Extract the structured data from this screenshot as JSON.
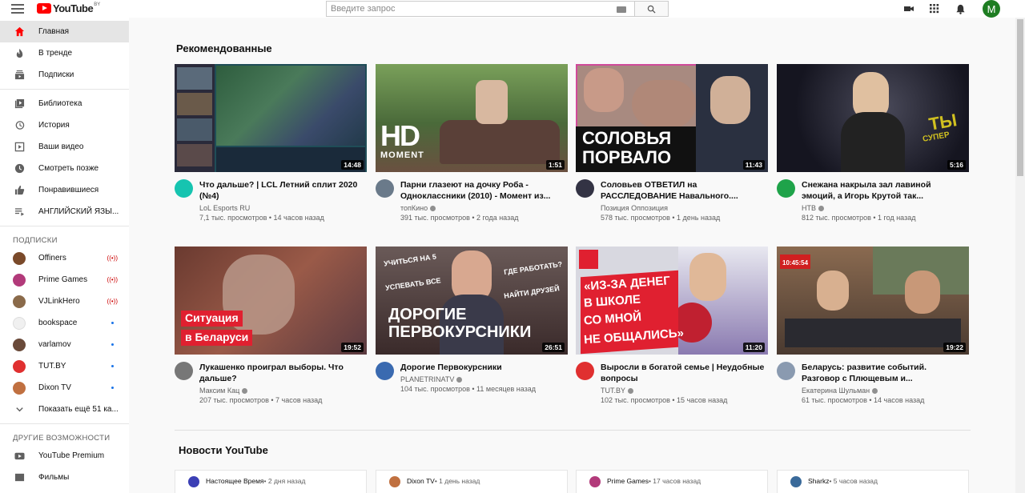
{
  "header": {
    "logo_text": "YouTube",
    "logo_region": "BY",
    "search_placeholder": "Введите запрос",
    "avatar_letter": "M"
  },
  "sidebar": {
    "main": [
      {
        "label": "Главная",
        "icon": "home-icon",
        "active": true
      },
      {
        "label": "В тренде",
        "icon": "trending-icon"
      },
      {
        "label": "Подписки",
        "icon": "subscriptions-icon"
      }
    ],
    "library": [
      {
        "label": "Библиотека",
        "icon": "library-icon"
      },
      {
        "label": "История",
        "icon": "history-icon"
      },
      {
        "label": "Ваши видео",
        "icon": "your-videos-icon"
      },
      {
        "label": "Смотреть позже",
        "icon": "watch-later-icon"
      },
      {
        "label": "Понравившиеся",
        "icon": "liked-icon"
      },
      {
        "label": "АНГЛИЙСКИЙ ЯЗЫ...",
        "icon": "playlist-icon"
      }
    ],
    "subscriptions_title": "ПОДПИСКИ",
    "subscriptions": [
      {
        "label": "Offiners",
        "color": "#7a4a2a",
        "badge": "live"
      },
      {
        "label": "Prime Games",
        "color": "#b23a7a",
        "badge": "live"
      },
      {
        "label": "VJLinkHero",
        "color": "#8a6a4a",
        "badge": "live"
      },
      {
        "label": "bookspace",
        "color": "#f0f0f0",
        "badge": "dot"
      },
      {
        "label": "varlamov",
        "color": "#6a4a3a",
        "badge": "dot"
      },
      {
        "label": "TUT.BY",
        "color": "#e03030",
        "badge": "dot"
      },
      {
        "label": "Dixon TV",
        "color": "#c07040",
        "badge": "dot"
      }
    ],
    "show_more": "Показать ещё 51 ка...",
    "other_title": "ДРУГИЕ ВОЗМОЖНОСТИ",
    "other": [
      {
        "label": "YouTube Premium",
        "icon": "youtube-premium-icon"
      },
      {
        "label": "Фильмы",
        "icon": "movies-icon"
      }
    ]
  },
  "main": {
    "recommended_title": "Рекомендованные",
    "videos": [
      {
        "title": "Что дальше? | LCL Летний сплит 2020 (№4)",
        "channel": "LoL Esports RU",
        "verified": false,
        "stats": "7,1 тыс. просмотров • 14 часов назад",
        "duration": "14:48",
        "avatar_color": "#16c4b0"
      },
      {
        "title": "Парни глазеют на дочку Роба - Одноклассники (2010) - Момент из...",
        "channel": "топКино",
        "verified": true,
        "stats": "391 тыс. просмотров • 2 года назад",
        "duration": "1:51",
        "avatar_color": "#6a7a8a",
        "thumb_text_1": "HD",
        "thumb_text_2": "MOMENT"
      },
      {
        "title": "Соловьев ОТВЕТИЛ на РАССЛЕДОВАНИЕ Навального....",
        "channel": "Позиция Оппозиция",
        "verified": false,
        "stats": "578 тыс. просмотров • 1 день назад",
        "duration": "11:43",
        "avatar_color": "#334",
        "thumb_text_1": "СОЛОВЬЯ",
        "thumb_text_2": "ПОРВАЛО"
      },
      {
        "title": "Снежана накрыла зал лавиной эмоций, а Игорь Крутой так...",
        "channel": "НТВ",
        "verified": true,
        "stats": "812 тыс. просмотров • 1 год назад",
        "duration": "5:16",
        "avatar_color": "#1fa34a",
        "thumb_text_1": "ТЫ",
        "thumb_text_2": "СУПЕР"
      },
      {
        "title": "Лукашенко проиграл выборы. Что дальше?",
        "channel": "Максим Кац",
        "verified": true,
        "stats": "207 тыс. просмотров • 7 часов назад",
        "duration": "19:52",
        "avatar_color": "#777",
        "thumb_text_1": "Ситуация",
        "thumb_text_2": "в Беларуси"
      },
      {
        "title": "Дорогие Первокурсники",
        "channel": "PLANETRINATV",
        "verified": true,
        "stats": "104 тыс. просмотров • 11 месяцев назад",
        "duration": "26:51",
        "avatar_color": "#3a6ab0",
        "thumb_text_1": "ДОРОГИЕ",
        "thumb_text_2": "ПЕРВОКУРСНИКИ",
        "thumb_text_3": "УЧИТЬСЯ НА 5",
        "thumb_text_4": "УСПЕВАТЬ ВСЕ",
        "thumb_text_5": "ГДЕ РАБОТАТЬ?",
        "thumb_text_6": "НАЙТИ ДРУЗЕЙ"
      },
      {
        "title": "Выросли в богатой семье | Неудобные вопросы",
        "channel": "TUT.BY",
        "verified": true,
        "stats": "102 тыс. просмотров • 15 часов назад",
        "duration": "11:20",
        "avatar_color": "#e03030",
        "thumb_text_1": "«ИЗ-ЗА ДЕНЕГ",
        "thumb_text_2": "В ШКОЛЕ",
        "thumb_text_3": "СО МНОЙ",
        "thumb_text_4": "НЕ ОБЩАЛИСЬ»"
      },
      {
        "title": "Беларусь: развитие событий. Разговор с Плющевым и...",
        "channel": "Екатерина Шульман",
        "verified": true,
        "stats": "61 тыс. просмотров • 14 часов назад",
        "duration": "19:22",
        "avatar_color": "#8a9ab0",
        "thumb_text_1": "10:45:54"
      }
    ],
    "news_title": "Новости YouTube",
    "posts": [
      {
        "channel": "Настоящее Время",
        "time": " • 2 дня назад",
        "avatar_color": "#3b3fb5"
      },
      {
        "channel": "Dixon TV",
        "time": " • 1 день назад",
        "avatar_color": "#c07040"
      },
      {
        "channel": "Prime Games",
        "time": " • 17 часов назад",
        "avatar_color": "#b23a7a"
      },
      {
        "channel": "Sharkz",
        "time": " • 5 часов назад",
        "avatar_color": "#3a6a9a"
      }
    ]
  }
}
